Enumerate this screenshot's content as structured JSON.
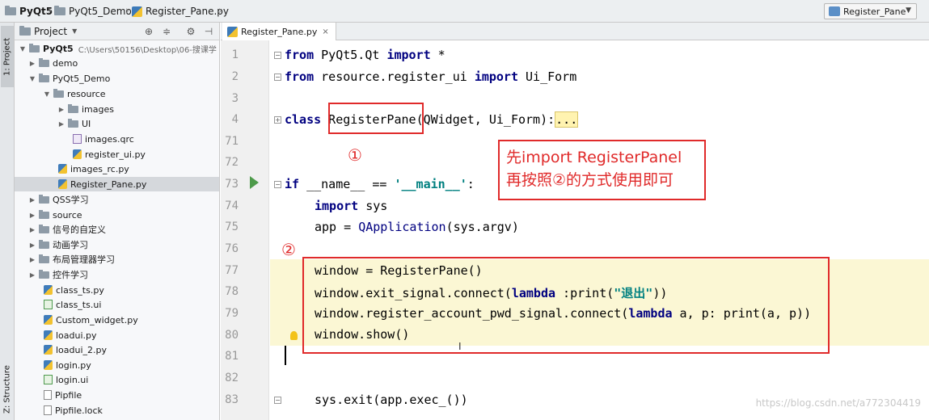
{
  "breadcrumbs": [
    "PyQt5",
    "PyQt5_Demo",
    "Register_Pane.py"
  ],
  "run_config": "Register_Pane",
  "tool_strip": {
    "project_tab": "1: Project",
    "structure_tab": "Z: Structure"
  },
  "project_panel": {
    "title": "Project",
    "tree": [
      {
        "label": "PyQt5",
        "path": "C:\\Users\\50156\\Desktop\\06-搜课学"
      },
      {
        "label": "demo"
      },
      {
        "label": "PyQt5_Demo"
      },
      {
        "label": "resource"
      },
      {
        "label": "images"
      },
      {
        "label": "UI"
      },
      {
        "label": "images.qrc"
      },
      {
        "label": "register_ui.py"
      },
      {
        "label": "images_rc.py"
      },
      {
        "label": "Register_Pane.py"
      },
      {
        "label": "QSS学习"
      },
      {
        "label": "source"
      },
      {
        "label": "信号的自定义"
      },
      {
        "label": "动画学习"
      },
      {
        "label": "布局管理器学习"
      },
      {
        "label": "控件学习"
      },
      {
        "label": "class_ts.py"
      },
      {
        "label": "class_ts.ui"
      },
      {
        "label": "Custom_widget.py"
      },
      {
        "label": "loadui.py"
      },
      {
        "label": "loadui_2.py"
      },
      {
        "label": "login.py"
      },
      {
        "label": "login.ui"
      },
      {
        "label": "Pipfile"
      },
      {
        "label": "Pipfile.lock"
      }
    ]
  },
  "editor": {
    "tab_label": "Register_Pane.py",
    "line_numbers": [
      "1",
      "2",
      "3",
      "4",
      "71",
      "72",
      "73",
      "74",
      "75",
      "76",
      "77",
      "78",
      "79",
      "80",
      "81",
      "82",
      "83"
    ],
    "code": {
      "l1_from": "from",
      "l1_mod": " PyQt5.Qt ",
      "l1_import": "import",
      "l1_rest": " *",
      "l2_from": "from",
      "l2_mod": " resource.register_ui ",
      "l2_import": "import",
      "l2_rest": " Ui_Form",
      "l4_class": "class",
      "l4_name": " RegisterPane",
      "l4_rest": "(QWidget, Ui_Form):",
      "l4_dots": "...",
      "l73_if": "if",
      "l73_name": " __name__ ",
      "l73_eq": "== ",
      "l73_str": "'__main__'",
      "l73_colon": ":",
      "l74_import": "import",
      "l74_rest": " sys",
      "l75_a": "app = ",
      "l75_fn": "QApplication",
      "l75_b": "(sys.argv)",
      "l77": "window = RegisterPane()",
      "l78_a": "window.exit_signal.connect(",
      "l78_kw": "lambda",
      "l78_b": " :print(",
      "l78_str": "\"退出\"",
      "l78_c": "))",
      "l79_a": "window.register_account_pwd_signal.connect(",
      "l79_kw": "lambda",
      "l79_b": " a, p: print(a, p))",
      "l80": "window.show()",
      "l83": "sys.exit(app.exec_())"
    }
  },
  "annotations": {
    "marker1": "①",
    "marker2": "②",
    "callout_line1": "先import RegisterPanel",
    "callout_line2": "再按照②的方式使用即可"
  },
  "watermark": "https://blog.csdn.net/a772304419",
  "colors": {
    "annotation_red": "#e02a2a",
    "keyword_navy": "#000080",
    "string_teal": "#008080",
    "highlight_yellow": "#fbf7d4"
  }
}
